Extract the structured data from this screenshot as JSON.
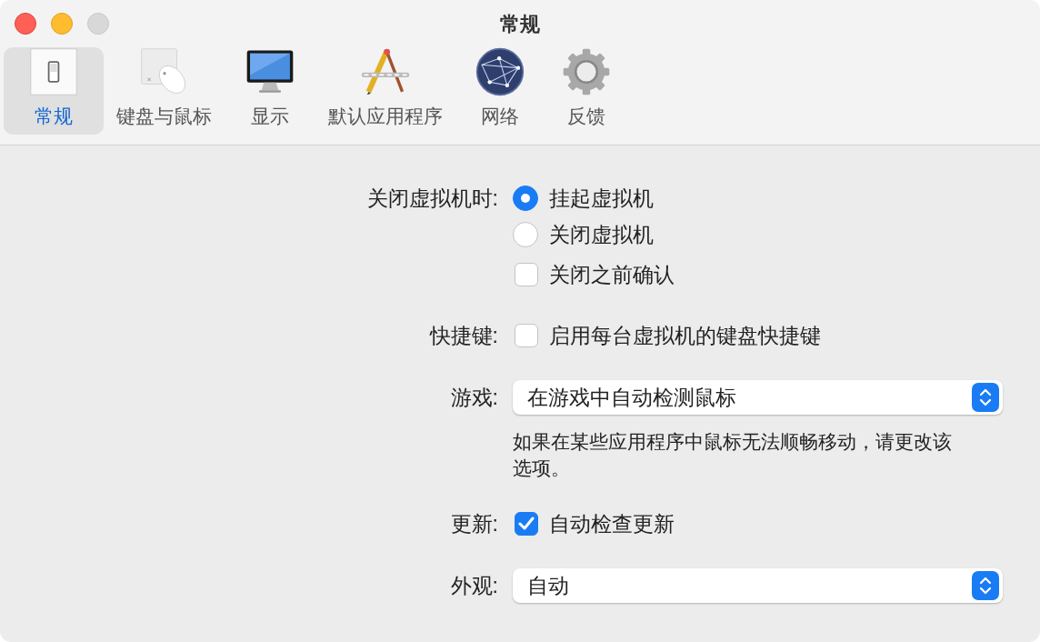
{
  "window": {
    "title": "常规"
  },
  "tabs": [
    {
      "label": "常规",
      "kind": "switch",
      "selected": true
    },
    {
      "label": "键盘与鼠标",
      "kind": "mouse",
      "selected": false
    },
    {
      "label": "显示",
      "kind": "monitor",
      "selected": false
    },
    {
      "label": "默认应用程序",
      "kind": "app",
      "selected": false
    },
    {
      "label": "网络",
      "kind": "globe",
      "selected": false
    },
    {
      "label": "反馈",
      "kind": "gear",
      "selected": false
    }
  ],
  "settings": [
    {
      "kind": "radios",
      "label": "关闭虚拟机时:",
      "options": [
        {
          "label": "挂起虚拟机",
          "selected": true
        },
        {
          "label": "关闭虚拟机",
          "selected": false
        }
      ]
    },
    {
      "kind": "checkbox",
      "text": "关闭之前确认",
      "checked": false
    },
    {
      "kind": "checkbox",
      "label": "快捷键:",
      "text": "启用每台虚拟机的键盘快捷键",
      "checked": false
    },
    {
      "kind": "popup",
      "label": "游戏:",
      "value": "在游戏中自动检测鼠标",
      "note": "如果在某些应用程序中鼠标无法顺畅移动，请更改该选项。"
    },
    {
      "kind": "checkbox",
      "label": "更新:",
      "text": "自动检查更新",
      "checked": true
    },
    {
      "kind": "popup",
      "label": "外观:",
      "value": "自动"
    }
  ]
}
